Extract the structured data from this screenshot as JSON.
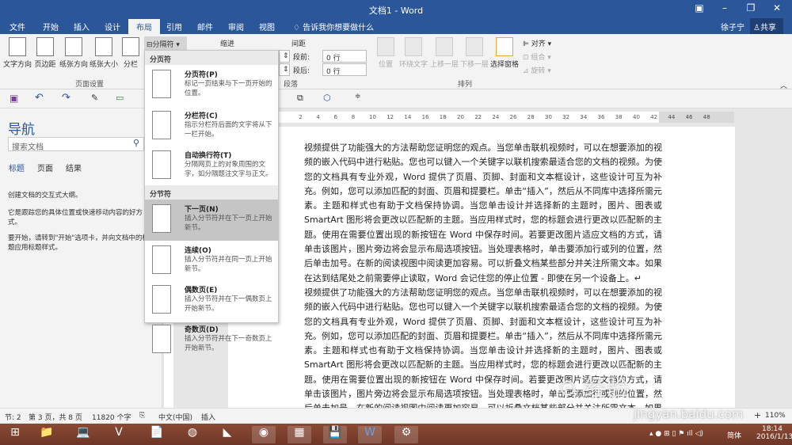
{
  "window": {
    "title": "文档1 - Word",
    "user": "徐子宁",
    "share": "共享"
  },
  "tabs": [
    "文件",
    "开始",
    "插入",
    "设计",
    "布局",
    "引用",
    "邮件",
    "审阅",
    "视图"
  ],
  "tell_me": "告诉我你想要做什么",
  "ribbon": {
    "page_setup": {
      "buttons": [
        "文字方向",
        "页边距",
        "纸张方向",
        "纸张大小",
        "分栏"
      ],
      "label": "页面设置"
    },
    "breaks_button": "分隔符",
    "indent_label": "缩进",
    "spacing": {
      "label": "间距",
      "before_label": "段前:",
      "before_value": "0 行",
      "after_label": "段后:",
      "after_value": "0 行"
    },
    "paragraph_label": "段落",
    "arrange": {
      "buttons": [
        "位置",
        "环绕文字",
        "上移一层",
        "下移一层",
        "选择窗格"
      ],
      "small": [
        "对齐",
        "组合",
        "旋转"
      ],
      "label": "排列"
    }
  },
  "menu": {
    "section1": "分页符",
    "section2": "分节符",
    "items": [
      {
        "title": "分页符(P)",
        "desc": "标记一页结束与下一页开始的位置。"
      },
      {
        "title": "分栏符(C)",
        "desc": "指示分栏符后面的文字将从下一栏开始。"
      },
      {
        "title": "自动换行符(T)",
        "desc": "分隔网页上的对象周围的文字，如分隔题注文字与正文。"
      },
      {
        "title": "下一页(N)",
        "desc": "插入分节符并在下一页上开始新节。"
      },
      {
        "title": "连续(O)",
        "desc": "插入分节符并在同一页上开始新节。"
      },
      {
        "title": "偶数页(E)",
        "desc": "插入分节符并在下一偶数页上开始新节。"
      },
      {
        "title": "奇数页(D)",
        "desc": "插入分节符并在下一奇数页上开始新节。"
      }
    ]
  },
  "nav": {
    "title": "导航",
    "search_placeholder": "搜索文档",
    "tabs": [
      "标题",
      "页面",
      "结果"
    ],
    "text1": "创建文档的交互式大纲。",
    "text2": "它是跟踪您的具体位置或快速移动内容的好方式。",
    "text3": "要开始，请转到\"开始\"选项卡，并向文档中的标题应用标题样式。"
  },
  "ruler": [
    "2",
    "2",
    "4",
    "6",
    "8",
    "10",
    "12",
    "14",
    "16",
    "18",
    "20",
    "22",
    "24",
    "26",
    "28",
    "30",
    "32",
    "34",
    "36",
    "38",
    "40",
    "42",
    "44",
    "46",
    "48"
  ],
  "document": {
    "paragraph": "视频提供了功能强大的方法帮助您证明您的观点。当您单击联机视频时，可以在想要添加的视频的嵌入代码中进行粘贴。您也可以键入一个关键字以联机搜索最适合您的文档的视频。为使您的文档具有专业外观，Word 提供了页眉、页脚、封面和文本框设计，这些设计可互为补充。例如，您可以添加匹配的封面、页眉和提要栏。单击“插入”，然后从不同库中选择所需元素。主题和样式也有助于文档保持协调。当您单击设计并选择新的主题时，图片、图表或 SmartArt 图形将会更改以匹配新的主题。当应用样式时，您的标题会进行更改以匹配新的主题。使用在需要位置出现的新按钮在 Word 中保存时间。若要更改图片适应文档的方式，请单击该图片，图片旁边将会显示布局选项按钮。当处理表格时，单击要添加行或列的位置，然后单击加号。在新的阅读视图中阅读更加容易。可以折叠文档某些部分并关注所需文本。如果在达到结尾处之前需要停止读取，Word 会记住您的停止位置 - 即使在另一个设备上。↵"
  },
  "status": {
    "section": "节: 2",
    "page": "第 3 页，共 8 页",
    "words": "11820 个字",
    "lang": "中文(中国)",
    "mode": "插入",
    "zoom": "110%"
  },
  "taskbar": {
    "time": "18:14",
    "date": "2016/1/13",
    "ime": "简体"
  },
  "watermark": "jingyan.baidu.com"
}
